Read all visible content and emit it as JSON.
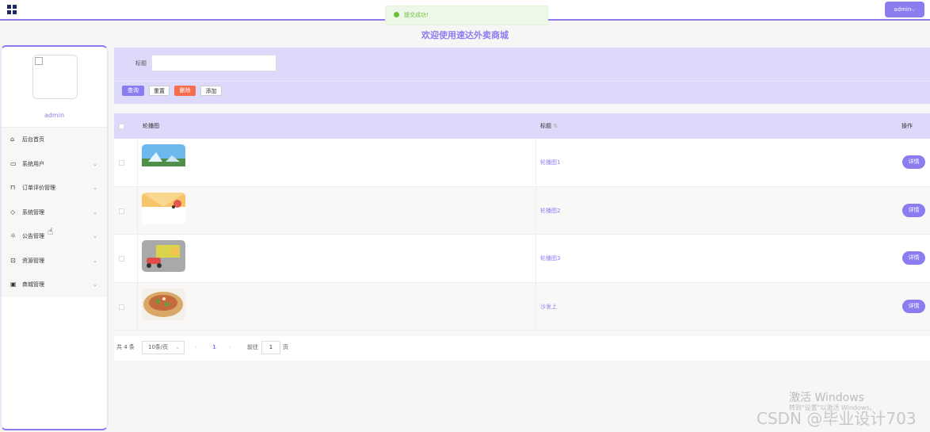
{
  "topbar": {
    "user_button": "admin⌵"
  },
  "toast": {
    "message": "提交成功!"
  },
  "site_title": "欢迎使用速达外卖商城",
  "sidebar": {
    "username": "admin",
    "items": [
      {
        "label": "后台首页",
        "icon": "home-icon",
        "has_arrow": false
      },
      {
        "label": "系统用户",
        "icon": "monitor-icon",
        "has_arrow": true
      },
      {
        "label": "订单评价管理",
        "icon": "bookmark-icon",
        "has_arrow": true
      },
      {
        "label": "系统管理",
        "icon": "tag-icon",
        "has_arrow": true
      },
      {
        "label": "公告管理",
        "icon": "sun-icon",
        "has_arrow": true
      },
      {
        "label": "资源管理",
        "icon": "inbox-icon",
        "has_arrow": true
      },
      {
        "label": "商城管理",
        "icon": "clipboard-icon",
        "has_arrow": true
      }
    ]
  },
  "search": {
    "title_label": "标题",
    "title_value": "",
    "query_label": "查询",
    "reset_label": "重置",
    "delete_label": "删除",
    "add_label": "添加"
  },
  "table": {
    "col_image": "轮播图",
    "col_title": "标题",
    "col_action": "操作",
    "detail_label": "详情",
    "rows": [
      {
        "title": "轮播图1",
        "image": "scenery-image"
      },
      {
        "title": "轮播图2",
        "image": "delivery-scooter-image"
      },
      {
        "title": "轮播图3",
        "image": "delivery-truck-image"
      },
      {
        "title": "沙发上",
        "image": "food-image"
      }
    ]
  },
  "pagination": {
    "total": "共 4 条",
    "page_size": "10条/页",
    "current_page": "1",
    "goto_label": "前往",
    "goto_value": "1",
    "page_suffix": "页"
  },
  "overlay": {
    "activate_title": "激活 Windows",
    "activate_sub": "转到\"设置\"以激活 Windows。",
    "csdn_watermark": "CSDN @毕业设计703"
  },
  "colors": {
    "accent": "#8b7cf0",
    "danger": "#f56c4c",
    "success": "#67c23a"
  }
}
